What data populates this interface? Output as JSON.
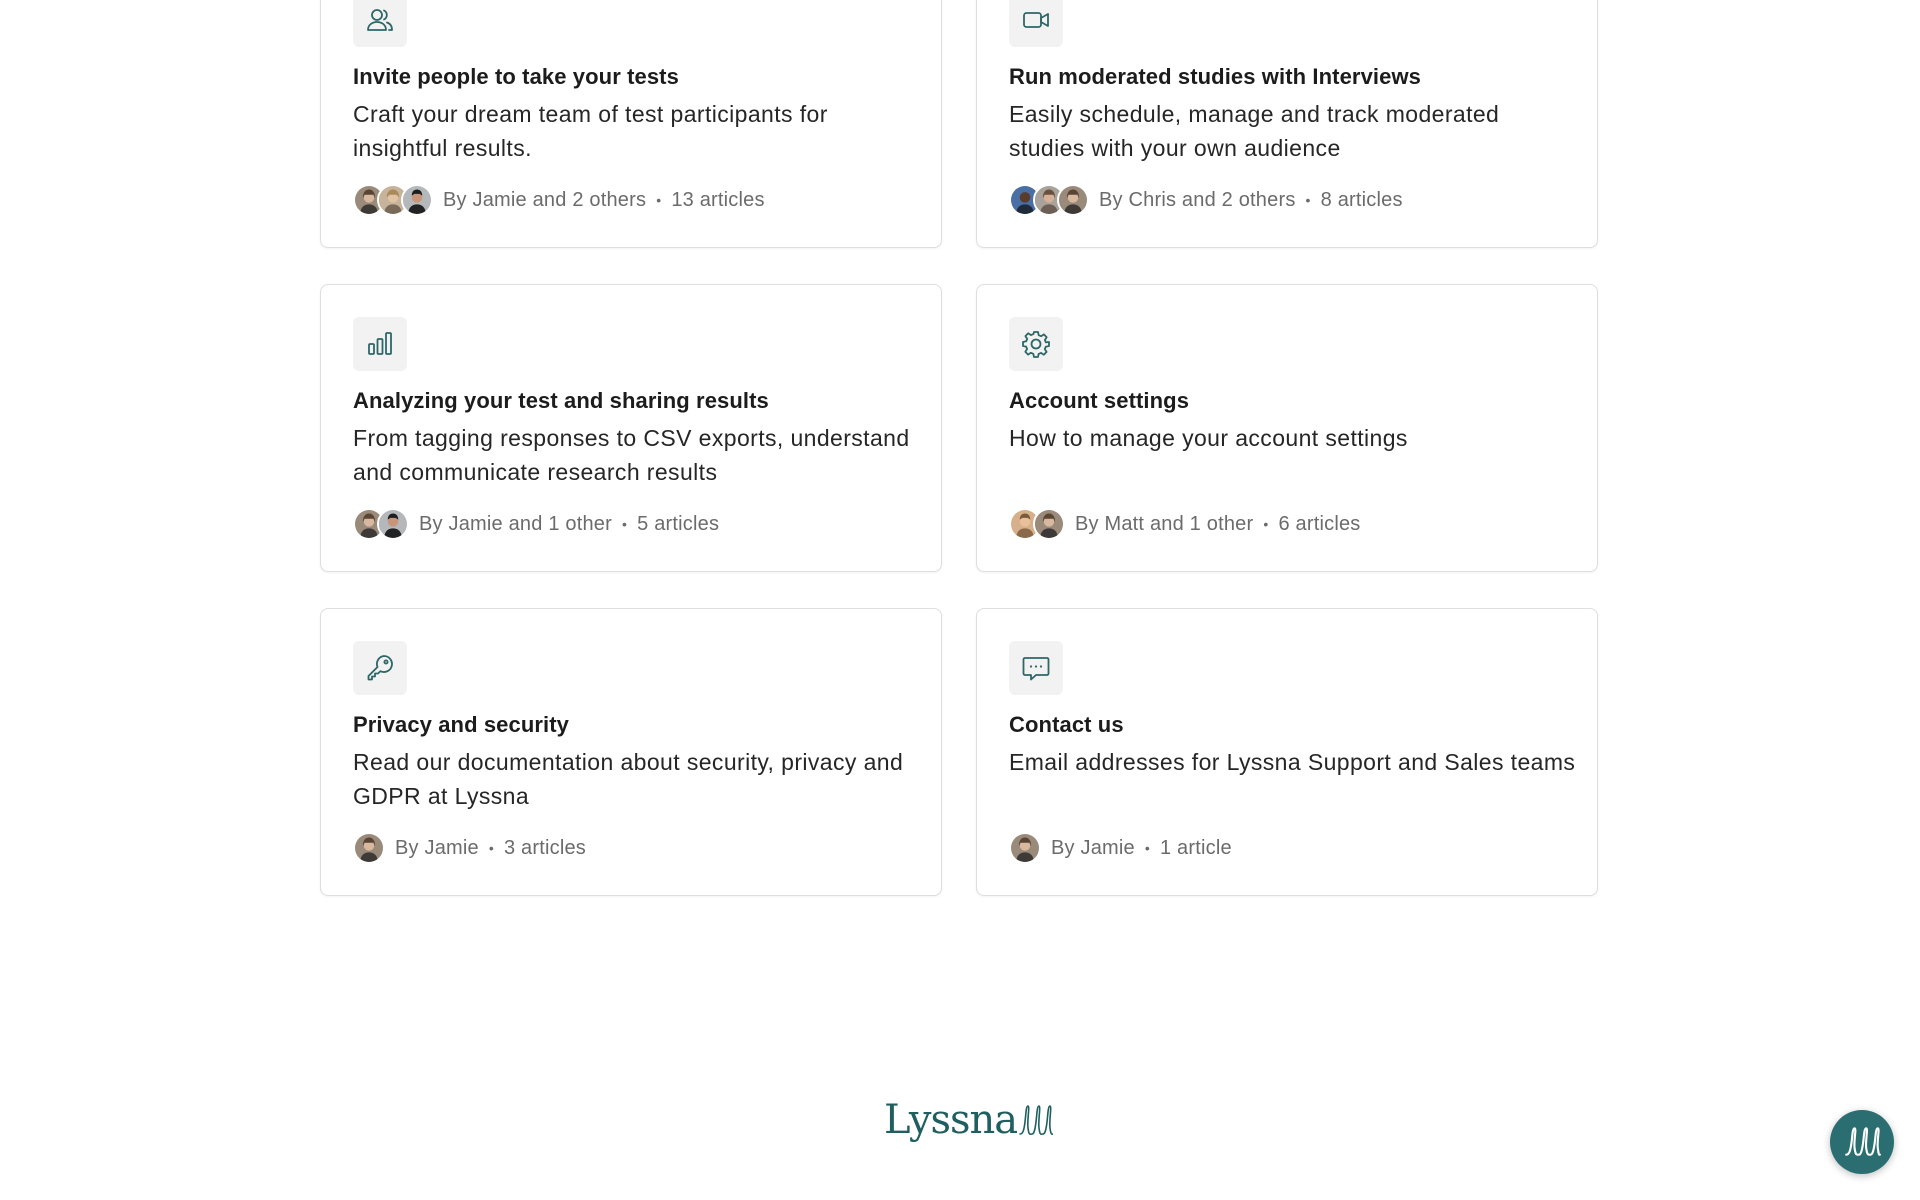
{
  "cards": [
    {
      "icon": "people-icon",
      "title": "Invite people to take your tests",
      "description": "Craft your dream team of test participants for insightful results.",
      "author_line": "By Jamie and 2 others",
      "separator": "•",
      "article_count": "13 articles"
    },
    {
      "icon": "video-camera-icon",
      "title": "Run moderated studies with Interviews",
      "description": "Easily schedule, manage and track moderated studies with your own audience",
      "author_line": "By Chris and 2 others",
      "separator": "•",
      "article_count": "8 articles"
    },
    {
      "icon": "bar-chart-icon",
      "title": "Analyzing your test and sharing results",
      "description": "From tagging responses to CSV exports, understand and communicate research results",
      "author_line": "By Jamie and 1 other",
      "separator": "•",
      "article_count": "5 articles"
    },
    {
      "icon": "gear-icon",
      "title": "Account settings",
      "description": "How to manage your account settings",
      "author_line": "By Matt and 1 other",
      "separator": "•",
      "article_count": "6 articles"
    },
    {
      "icon": "key-icon",
      "title": "Privacy and security",
      "description": "Read our documentation about security, privacy and GDPR at Lyssna",
      "author_line": "By Jamie",
      "separator": "•",
      "article_count": "3 articles"
    },
    {
      "icon": "chat-bubble-icon",
      "title": "Contact us",
      "description": "Email addresses for Lyssna Support and Sales teams",
      "author_line": "By Jamie",
      "separator": "•",
      "article_count": "1 article"
    }
  ],
  "footer": {
    "logo_text": "Lyssna"
  },
  "chat_launcher": {
    "icon": "lyssna-loops-icon"
  },
  "colors": {
    "brand": "#1f5f60",
    "chat_button": "#2b6e72",
    "card_border": "#dedede",
    "icon_box_bg": "#f2f2f2"
  }
}
